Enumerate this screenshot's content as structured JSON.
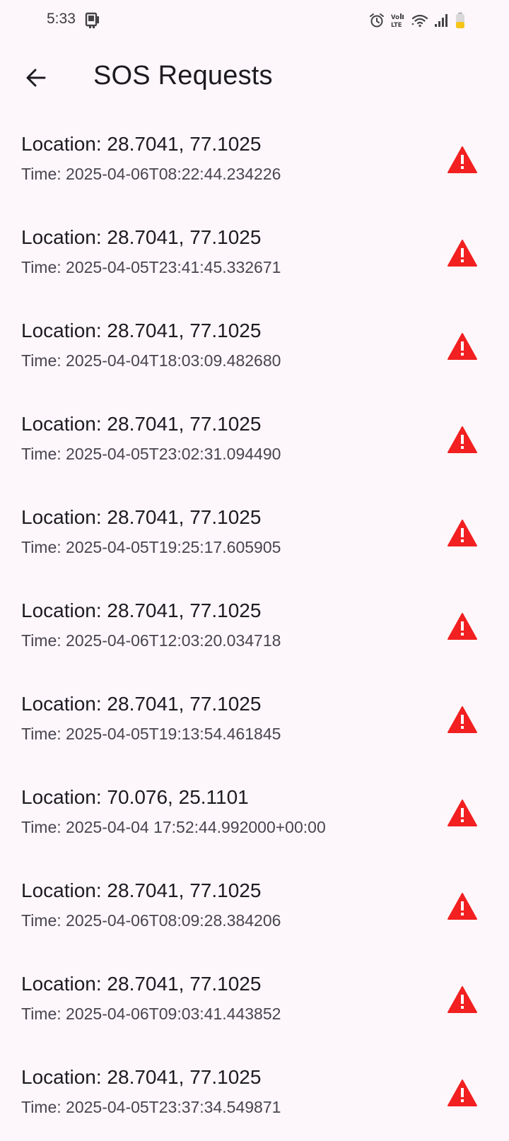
{
  "status_bar": {
    "time": "5:33",
    "icons": [
      "sim-card-icon",
      "alarm-icon",
      "volte-icon",
      "wifi-icon",
      "signal-icon",
      "battery-icon"
    ]
  },
  "app_bar": {
    "back_icon": "arrow-back-icon",
    "title": "SOS Requests"
  },
  "colors": {
    "background": "#fdf7fc",
    "warning": "#f22020",
    "battery": "#f5c518"
  },
  "requests": [
    {
      "location": "Location: 28.7041, 77.1025",
      "time": "Time: 2025-04-06T08:22:44.234226",
      "icon": "warning-icon"
    },
    {
      "location": "Location: 28.7041, 77.1025",
      "time": "Time: 2025-04-05T23:41:45.332671",
      "icon": "warning-icon"
    },
    {
      "location": "Location: 28.7041, 77.1025",
      "time": "Time: 2025-04-04T18:03:09.482680",
      "icon": "warning-icon"
    },
    {
      "location": "Location: 28.7041, 77.1025",
      "time": "Time: 2025-04-05T23:02:31.094490",
      "icon": "warning-icon"
    },
    {
      "location": "Location: 28.7041, 77.1025",
      "time": "Time: 2025-04-05T19:25:17.605905",
      "icon": "warning-icon"
    },
    {
      "location": "Location: 28.7041, 77.1025",
      "time": "Time: 2025-04-06T12:03:20.034718",
      "icon": "warning-icon"
    },
    {
      "location": "Location: 28.7041, 77.1025",
      "time": "Time: 2025-04-05T19:13:54.461845",
      "icon": "warning-icon"
    },
    {
      "location": "Location: 70.076, 25.1101",
      "time": "Time: 2025-04-04 17:52:44.992000+00:00",
      "icon": "warning-icon"
    },
    {
      "location": "Location: 28.7041, 77.1025",
      "time": "Time: 2025-04-06T08:09:28.384206",
      "icon": "warning-icon"
    },
    {
      "location": "Location: 28.7041, 77.1025",
      "time": "Time: 2025-04-06T09:03:41.443852",
      "icon": "warning-icon"
    },
    {
      "location": "Location: 28.7041, 77.1025",
      "time": "Time: 2025-04-05T23:37:34.549871",
      "icon": "warning-icon"
    }
  ]
}
